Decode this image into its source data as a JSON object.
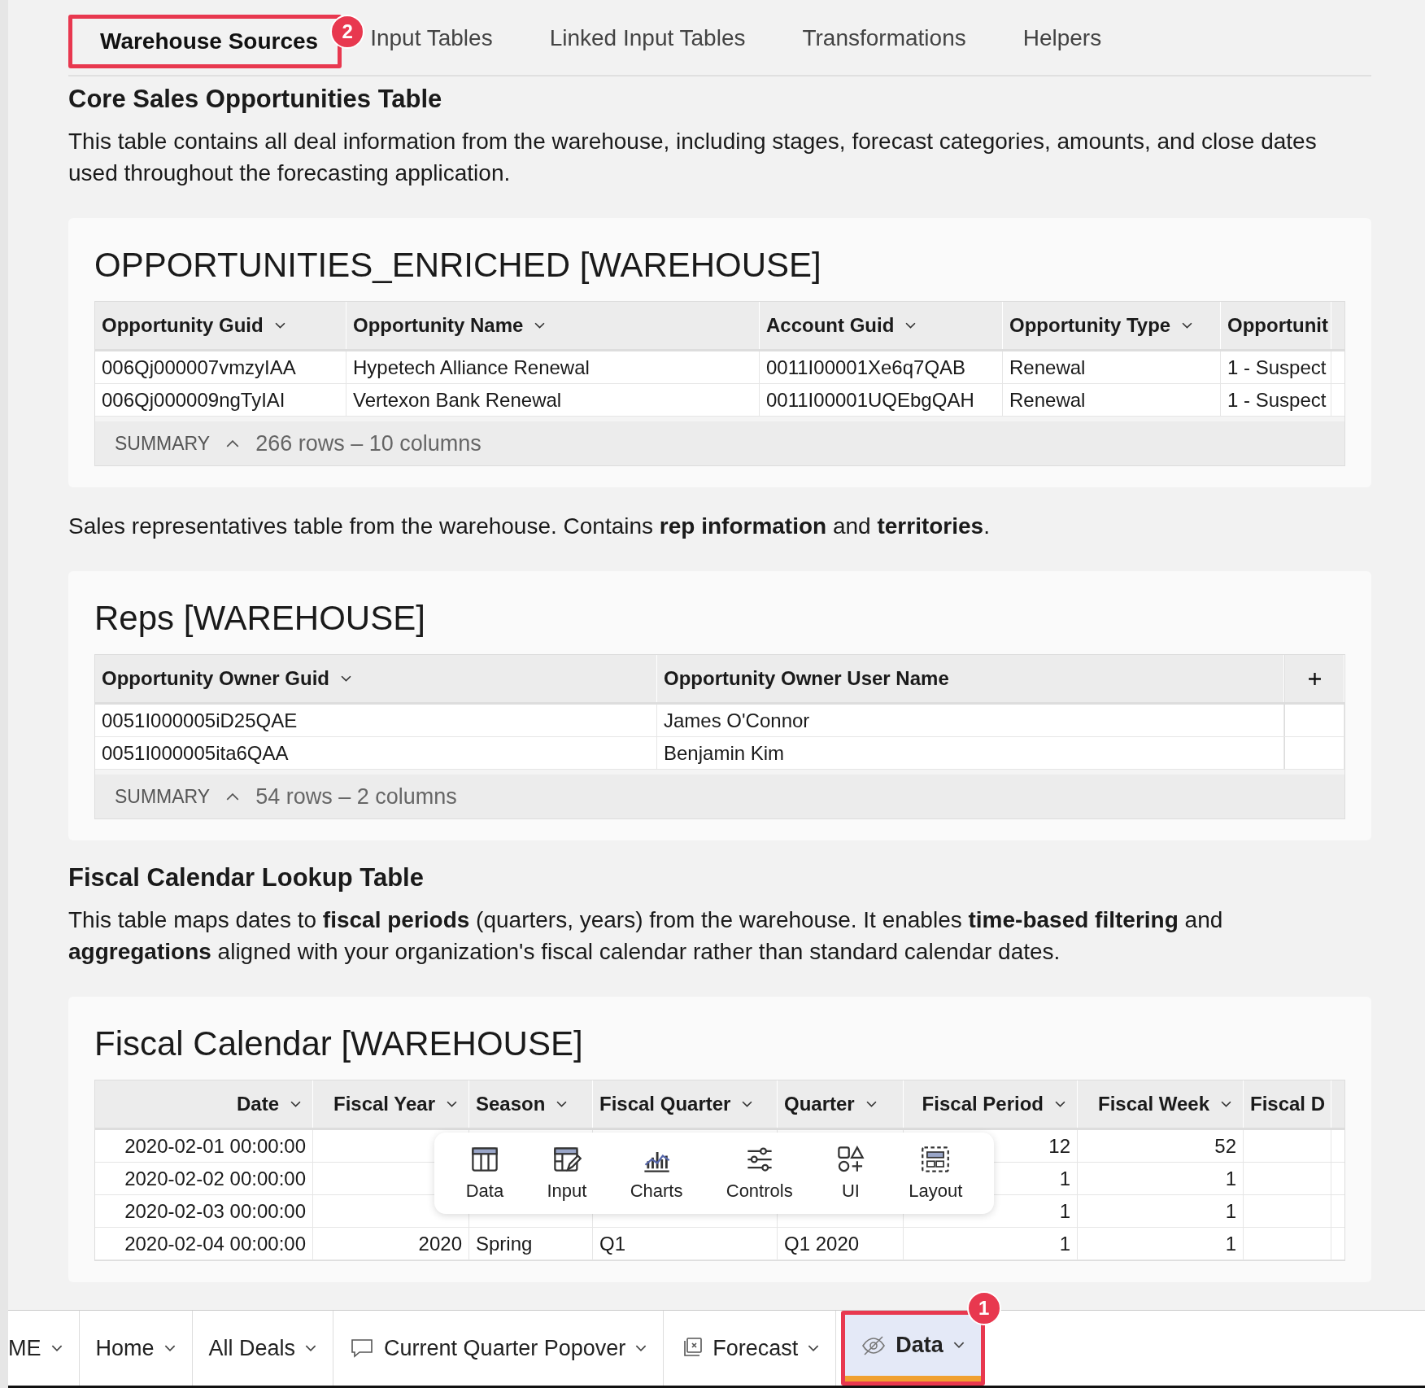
{
  "tabs": [
    {
      "label": "Warehouse Sources",
      "selected": true,
      "annotation": "2"
    },
    {
      "label": "Input Tables",
      "selected": false
    },
    {
      "label": "Linked Input Tables",
      "selected": false
    },
    {
      "label": "Transformations",
      "selected": false
    },
    {
      "label": "Helpers",
      "selected": false
    }
  ],
  "sections": [
    {
      "heading": "Core Sales Opportunities Table",
      "description": "This table contains all deal information from the warehouse, including stages, forecast categories, amounts, and close dates used throughout the forecasting application.",
      "table": {
        "title": "OPPORTUNITIES_ENRICHED [WAREHOUSE]",
        "add_column": false,
        "columns": [
          "Opportunity Guid",
          "Opportunity Name",
          "Account Guid",
          "Opportunity Type",
          "Opportunit"
        ],
        "rows": [
          [
            "006Qj000007vmzyIAA",
            "Hypetech Alliance Renewal",
            "0011I00001Xe6q7QAB",
            "Renewal",
            "1 - Suspect"
          ],
          [
            "006Qj000009ngTyIAI",
            "Vertexon Bank Renewal",
            "0011I00001UQEbgQAH",
            "Renewal",
            "1 - Suspect"
          ]
        ],
        "summary_label": "SUMMARY",
        "summary": "266 rows – 10 columns"
      }
    },
    {
      "description": "Sales representatives table from the warehouse. Contains **rep information** and **territories**.",
      "table": {
        "title": "Reps [WAREHOUSE]",
        "add_column": true,
        "columns": [
          "Opportunity Owner Guid",
          "Opportunity Owner User Name"
        ],
        "rows": [
          [
            "0051I000005iD25QAE",
            "James O'Connor"
          ],
          [
            "0051I000005ita6QAA",
            "Benjamin Kim"
          ]
        ],
        "summary_label": "SUMMARY",
        "summary": "54 rows – 2 columns"
      }
    },
    {
      "heading": "Fiscal Calendar Lookup Table",
      "description": "This table maps dates to **fiscal periods** (quarters, years) from the warehouse. It enables **time-based filtering** and **aggregations** aligned with your organization's fiscal calendar rather than standard calendar dates.",
      "table": {
        "title": "Fiscal Calendar [WAREHOUSE]",
        "add_column": false,
        "columns": [
          "Date",
          "Fiscal Year",
          "Season",
          "Fiscal Quarter",
          "Quarter",
          "Fiscal Period",
          "Fiscal Week",
          "Fiscal D"
        ],
        "rows": [
          [
            "2020-02-01 00:00:00",
            null,
            null,
            null,
            null,
            "12",
            "52",
            null
          ],
          [
            "2020-02-02 00:00:00",
            null,
            null,
            null,
            null,
            "1",
            "1",
            null
          ],
          [
            "2020-02-03 00:00:00",
            null,
            null,
            null,
            null,
            "1",
            "1",
            null
          ],
          [
            "2020-02-04 00:00:00",
            "2020",
            "Spring",
            "Q1",
            "Q1 2020",
            "1",
            "1",
            null
          ]
        ]
      }
    }
  ],
  "popup": [
    {
      "label": "Data"
    },
    {
      "label": "Input"
    },
    {
      "label": "Charts"
    },
    {
      "label": "Controls"
    },
    {
      "label": "UI"
    },
    {
      "label": "Layout"
    }
  ],
  "pages": [
    {
      "label": "ME",
      "kind": "plain",
      "selected": false
    },
    {
      "label": "Home",
      "kind": "plain",
      "selected": false
    },
    {
      "label": "All Deals",
      "kind": "plain",
      "selected": false
    },
    {
      "label": "Current Quarter Popover",
      "kind": "popover",
      "selected": false
    },
    {
      "label": "Forecast",
      "kind": "report",
      "selected": false
    },
    {
      "label": "Data",
      "kind": "hidden",
      "selected": true,
      "annotation": "1"
    }
  ]
}
